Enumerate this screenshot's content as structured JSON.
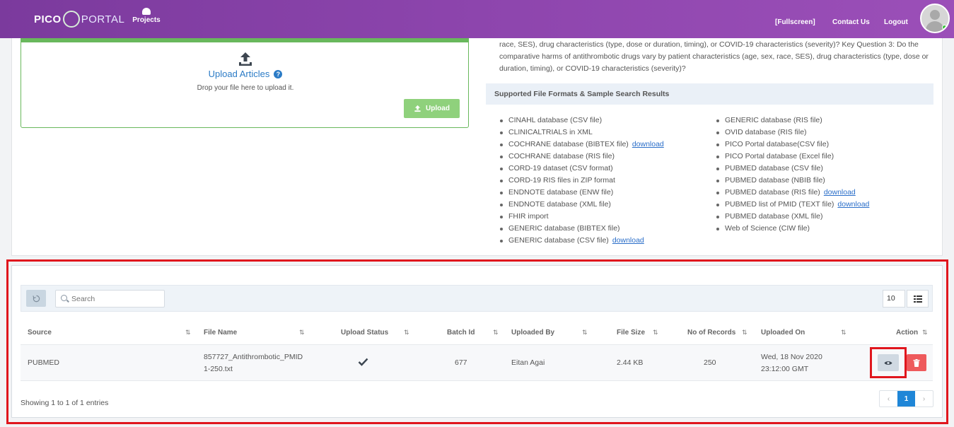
{
  "header": {
    "logo_left": "PICO",
    "logo_right": "PORTAL",
    "nav_projects": "Projects",
    "fullscreen": "[Fullscreen]",
    "contact": "Contact Us",
    "logout": "Logout",
    "brand_color": "#8d45ad"
  },
  "upload": {
    "title": "Upload Articles",
    "help": "?",
    "drop_hint": "Drop your file here to upload it.",
    "button": "Upload"
  },
  "question_text": "race, SES), drug characteristics (type, dose or duration, timing), or COVID-19 characteristics (severity)? Key Question 3: Do the comparative harms of antithrombotic drugs vary by patient characteristics (age, sex, race, SES), drug characteristics (type, dose or duration, timing), or COVID-19 characteristics (severity)?",
  "formats": {
    "heading": "Supported File Formats & Sample Search Results",
    "download_label": "download",
    "left": [
      {
        "label": "CINAHL database (CSV file)",
        "link": ""
      },
      {
        "label": "CLINICALTRIALS in XML",
        "link": ""
      },
      {
        "label": "COCHRANE database (BIBTEX file)",
        "link": "download"
      },
      {
        "label": "COCHRANE database (RIS file)",
        "link": ""
      },
      {
        "label": "CORD-19 dataset (CSV format)",
        "link": ""
      },
      {
        "label": "CORD-19 RIS files in ZIP format",
        "link": ""
      },
      {
        "label": "ENDNOTE database (ENW file)",
        "link": ""
      },
      {
        "label": "ENDNOTE database (XML file)",
        "link": ""
      },
      {
        "label": "FHIR import",
        "link": ""
      },
      {
        "label": "GENERIC database (BIBTEX file)",
        "link": ""
      },
      {
        "label": "GENERIC database (CSV file)",
        "link": "download"
      }
    ],
    "right": [
      {
        "label": "GENERIC database (RIS file)",
        "link": ""
      },
      {
        "label": "OVID database (RIS file)",
        "link": ""
      },
      {
        "label": "PICO Portal database(CSV file)",
        "link": ""
      },
      {
        "label": "PICO Portal database (Excel file)",
        "link": ""
      },
      {
        "label": "PUBMED database (CSV file)",
        "link": ""
      },
      {
        "label": "PUBMED database (NBIB file)",
        "link": ""
      },
      {
        "label": "PUBMED database (RIS file)",
        "link": "download"
      },
      {
        "label": "PUBMED list of PMID (TEXT file)",
        "link": "download"
      },
      {
        "label": "PUBMED database (XML file)",
        "link": ""
      },
      {
        "label": "Web of Science (CIW file)",
        "link": ""
      }
    ]
  },
  "table": {
    "search_placeholder": "Search",
    "page_size": "10",
    "columns": {
      "source": "Source",
      "file_name": "File Name",
      "upload_status": "Upload Status",
      "batch_id": "Batch Id",
      "uploaded_by": "Uploaded By",
      "file_size": "File Size",
      "records": "No of Records",
      "uploaded_on": "Uploaded On",
      "action": "Action"
    },
    "row": {
      "source": "PUBMED",
      "file_name_1": "857727_Antithrombotic_PMID",
      "file_name_2": "1-250.txt",
      "status_icon": "checkmark-icon",
      "batch_id": "677",
      "uploaded_by": "Eitan Agai",
      "file_size": "2.44 KB",
      "records": "250",
      "uploaded_on_1": "Wed, 18 Nov 2020",
      "uploaded_on_2": "23:12:00 GMT"
    },
    "showing": "Showing 1 to 1 of 1 entries",
    "pager": {
      "prev": "‹",
      "current": "1",
      "next": "›"
    }
  }
}
